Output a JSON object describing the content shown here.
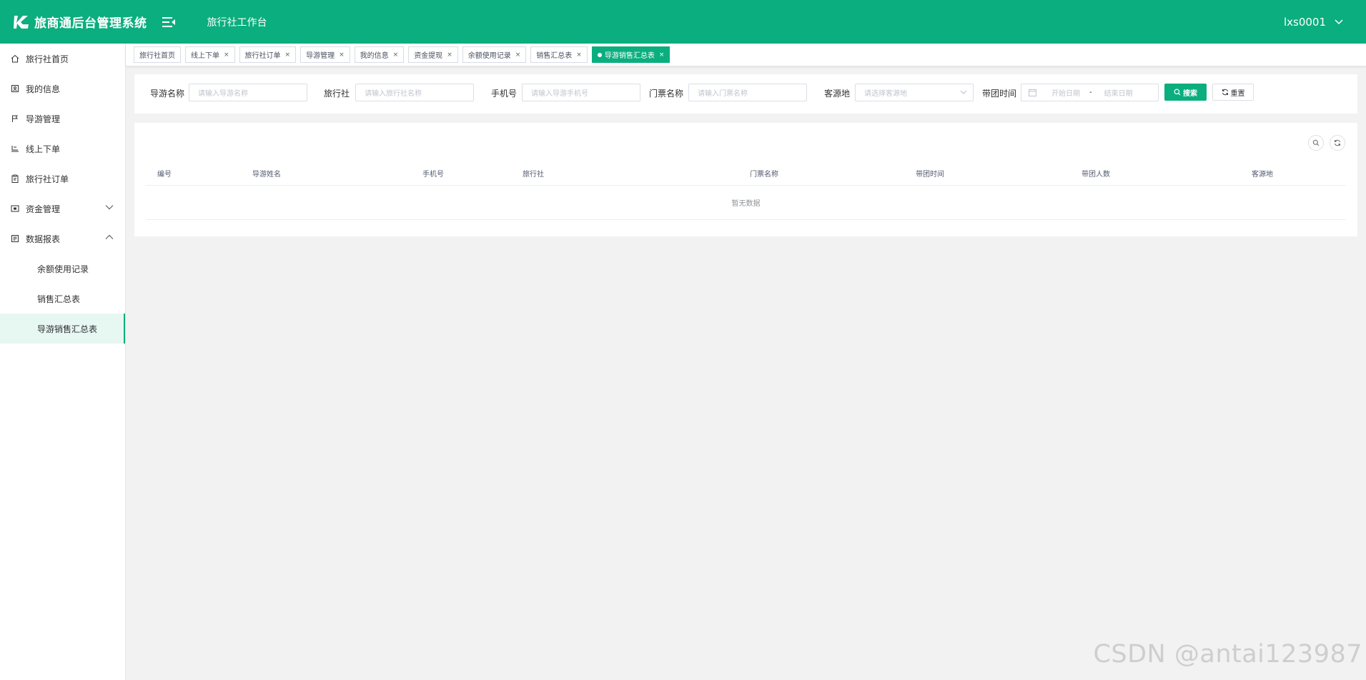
{
  "header": {
    "app_title": "旅商通后台管理系统",
    "workbench": "旅行社工作台",
    "username": "lxs0001"
  },
  "sidebar": {
    "items": [
      {
        "label": "旅行社首页",
        "icon": "home-icon"
      },
      {
        "label": "我的信息",
        "icon": "profile-icon"
      },
      {
        "label": "导游管理",
        "icon": "flag-icon"
      },
      {
        "label": "线上下单",
        "icon": "order-online-icon"
      },
      {
        "label": "旅行社订单",
        "icon": "clipboard-icon"
      },
      {
        "label": "资金管理",
        "icon": "wallet-icon"
      },
      {
        "label": "数据报表",
        "icon": "report-icon"
      }
    ],
    "sub_items": [
      {
        "label": "余额使用记录"
      },
      {
        "label": "销售汇总表"
      },
      {
        "label": "导游销售汇总表"
      }
    ]
  },
  "tags": [
    {
      "label": "旅行社首页"
    },
    {
      "label": "线上下单"
    },
    {
      "label": "旅行社订单"
    },
    {
      "label": "导游管理"
    },
    {
      "label": "我的信息"
    },
    {
      "label": "资金提现"
    },
    {
      "label": "余额使用记录"
    },
    {
      "label": "销售汇总表"
    },
    {
      "label": "导游销售汇总表"
    }
  ],
  "search": {
    "guide_name_label": "导游名称",
    "guide_name_placeholder": "请输入导游名称",
    "agency_label": "旅行社",
    "agency_placeholder": "请输入旅行社名称",
    "phone_label": "手机号",
    "phone_placeholder": "请输入导游手机号",
    "ticket_label": "门票名称",
    "ticket_placeholder": "请输入门票名称",
    "origin_label": "客源地",
    "origin_placeholder": "请选择客源地",
    "tour_time_label": "带团时间",
    "start_date_placeholder": "开始日期",
    "range_separator": "-",
    "end_date_placeholder": "结束日期",
    "search_button": "搜索",
    "reset_button": "重置"
  },
  "table": {
    "columns": [
      "编号",
      "导游姓名",
      "手机号",
      "旅行社",
      "门票名称",
      "带团时间",
      "带团人数",
      "客源地"
    ],
    "rows": [],
    "empty_text": "暂无数据"
  },
  "watermark": "CSDN @antai123987",
  "colors": {
    "brand": "#0bae7e",
    "active_menu_bg": "#e7f7f2",
    "page_bg": "#f2f2f2"
  }
}
